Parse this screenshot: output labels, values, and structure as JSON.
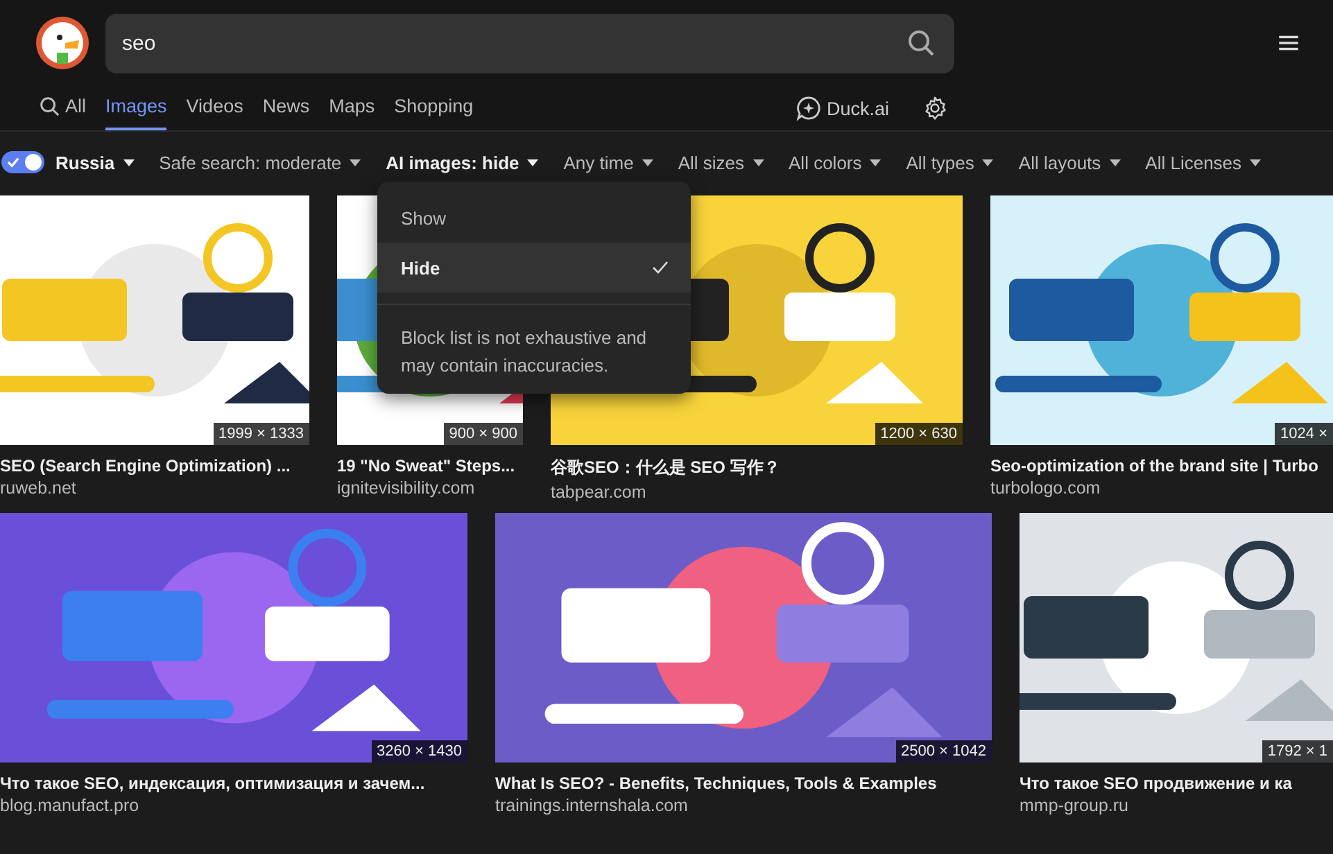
{
  "search": {
    "value": "seo"
  },
  "tabs": [
    {
      "label": "All",
      "icon": true,
      "selected": false
    },
    {
      "label": "Images",
      "icon": false,
      "selected": true
    },
    {
      "label": "Videos",
      "icon": false,
      "selected": false
    },
    {
      "label": "News",
      "icon": false,
      "selected": false
    },
    {
      "label": "Maps",
      "icon": false,
      "selected": false
    },
    {
      "label": "Shopping",
      "icon": false,
      "selected": false
    }
  ],
  "duck_ai": "Duck.ai",
  "region": {
    "on": true,
    "label": "Russia"
  },
  "filters": [
    {
      "label": "Safe search: moderate",
      "active": false
    },
    {
      "label": "AI images: hide",
      "active": true
    },
    {
      "label": "Any time",
      "active": false
    },
    {
      "label": "All sizes",
      "active": false
    },
    {
      "label": "All colors",
      "active": false
    },
    {
      "label": "All types",
      "active": false
    },
    {
      "label": "All layouts",
      "active": false
    },
    {
      "label": "All Licenses",
      "active": false
    }
  ],
  "dropdown": {
    "options": [
      {
        "label": "Show",
        "selected": false
      },
      {
        "label": "Hide",
        "selected": true
      }
    ],
    "note": "Block list is not exhaustive and may contain inaccuracies."
  },
  "results": [
    [
      {
        "title": "SEO (Search Engine Optimization) ...",
        "source": "ruweb.net",
        "size": "1999 × 1333"
      },
      {
        "title": "19 \"No Sweat\" Steps...",
        "source": "ignitevisibility.com",
        "size": "900 × 900"
      },
      {
        "title": "谷歌SEO：什么是 SEO 写作？",
        "source": "tabpear.com",
        "size": "1200 × 630"
      },
      {
        "title": "Seo-optimization of the brand site | Turbo",
        "source": "turbologo.com",
        "size": "1024 ×"
      }
    ],
    [
      {
        "title": "Что такое SEO, индексация, оптимизация и зачем...",
        "source": "blog.manufact.pro",
        "size": "3260 × 1430"
      },
      {
        "title": "What Is SEO? - Benefits, Techniques, Tools & Examples",
        "source": "trainings.internshala.com",
        "size": "2500 × 1042"
      },
      {
        "title": "Что такое SEO продвижение и ка",
        "source": "mmp-group.ru",
        "size": "1792 × 1"
      }
    ]
  ]
}
